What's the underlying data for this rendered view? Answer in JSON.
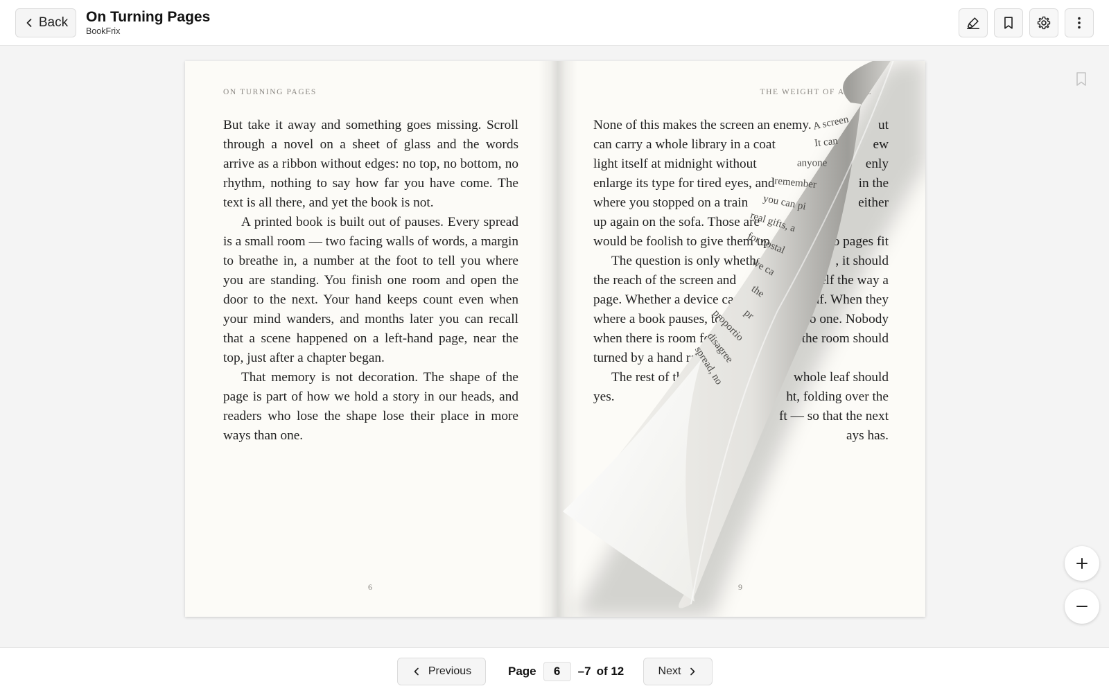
{
  "header": {
    "back_label": "Back",
    "title": "On Turning Pages",
    "subtitle": "BookFrix",
    "tools": [
      {
        "name": "highlight-icon"
      },
      {
        "name": "bookmark-icon"
      },
      {
        "name": "settings-gear-icon"
      },
      {
        "name": "more-vertical-icon"
      }
    ]
  },
  "spread": {
    "left": {
      "running_head": "On Turning Pages",
      "paragraphs": [
        "But take it away and something goes missing. Scroll through a novel on a sheet of glass and the words arrive as a ribbon without edges: no top, no bottom, no rhythm, nothing to say how far you have come. The text is all there, and yet the book is not.",
        "A printed book is built out of pauses. Every spread is a small room — two facing walls of words, a margin to breathe in, a number at the foot to tell you where you are standing. You finish one room and open the door to the next. Your hand keeps count even when your mind wanders, and months later you can recall that a scene happened on a left-hand page, near the top, just after a chapter began.",
        "That memory is not decoration. The shape of the page is part of how we hold a story in our heads, and readers who lose the shape lose their place in more ways than one."
      ],
      "folio": "6"
    },
    "right": {
      "running_head": "The Weight of a Page",
      "visible_lines": [
        {
          "a": "None of this makes the screen an enemy.",
          "b": "ut"
        },
        {
          "a": "can carry a whole library in a coat",
          "b": "ew"
        },
        {
          "a": "light itself at midnight without",
          "b": "enly"
        },
        {
          "a": "enlarge its type for tired eyes, and",
          "b": "in the"
        },
        {
          "a": "where you stopped on a train",
          "b": "either"
        },
        {
          "a": "up again on the sofa. Those are",
          "b": ""
        },
        {
          "a": "would be foolish to give them up",
          "b": "o pages fit"
        },
        {
          "a": "The question is only whether",
          "b": ", it should",
          "indent": true
        },
        {
          "a": "the reach of the screen and",
          "b": "elf the way a"
        },
        {
          "a": "page. Whether a device can",
          "b": "af. When they"
        },
        {
          "a": "where a book pauses, to lav",
          "b": "to one. Nobody"
        },
        {
          "a": "when there is room for",
          "b": "the room should"
        },
        {
          "a": "turned by a hand rat",
          "b": ""
        },
        {
          "a": "The rest of th",
          "b": "whole leaf should",
          "indent": true
        },
        {
          "a": "yes.",
          "b": "ht, folding over the"
        },
        {
          "a": "",
          "b": "ft — so that the next"
        },
        {
          "a": "",
          "b": "ays has."
        }
      ],
      "folio": "9"
    },
    "curl_back_text": [
      "A screen",
      "It can",
      "anyone",
      "remember",
      "you can pi",
      "real gifts, a",
      "for nostal",
      "we ca",
      "the",
      "pr",
      "proportio",
      "disagree",
      "spread, no"
    ]
  },
  "zoom": {
    "in_icon": "plus-icon",
    "out_icon": "minus-icon"
  },
  "footer": {
    "previous_label": "Previous",
    "next_label": "Next",
    "page_label": "Page",
    "current_page": "6",
    "range_suffix": "–7",
    "total_label": "of 12"
  }
}
